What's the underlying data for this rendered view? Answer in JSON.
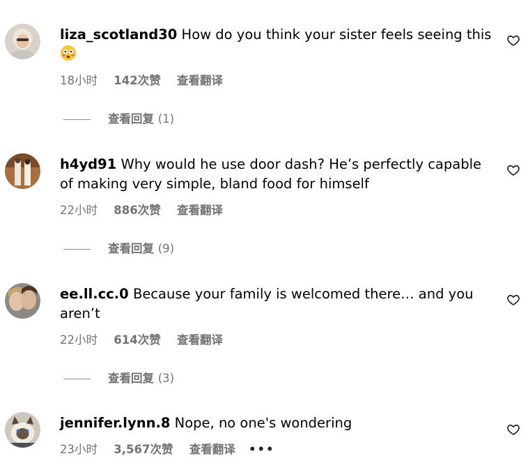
{
  "comments": [
    {
      "username": "liza_scotland30",
      "text": "How do you think your sister feels seeing this",
      "emoji": "flushed-face",
      "time": "18小时",
      "likes": "142次赞",
      "translate": "查看翻译",
      "replies_label": "查看回复",
      "replies_count": "(1)"
    },
    {
      "username": "h4yd91",
      "text": "Why would he use door dash? He’s perfectly capable of making very simple, bland food for himself",
      "time": "22小时",
      "likes": "886次赞",
      "translate": "查看翻译",
      "replies_label": "查看回复",
      "replies_count": "(9)"
    },
    {
      "username": "ee.ll.cc.0",
      "text": "Because your family is welcomed there… and you aren’t",
      "time": "22小时",
      "likes": "614次赞",
      "translate": "查看翻译",
      "replies_label": "查看回复",
      "replies_count": "(3)"
    },
    {
      "username": "jennifer.lynn.8",
      "text": "Nope, no one's wondering",
      "time": "23小时",
      "likes": "3,567次赞",
      "translate": "查看翻译",
      "more": "•••"
    }
  ],
  "icons": {
    "like": "heart-outline-icon",
    "emoji": "flushed-face-emoji"
  },
  "colors": {
    "meta_text": "#737373",
    "primary_text": "#000000",
    "divider": "#8e8e8e"
  }
}
